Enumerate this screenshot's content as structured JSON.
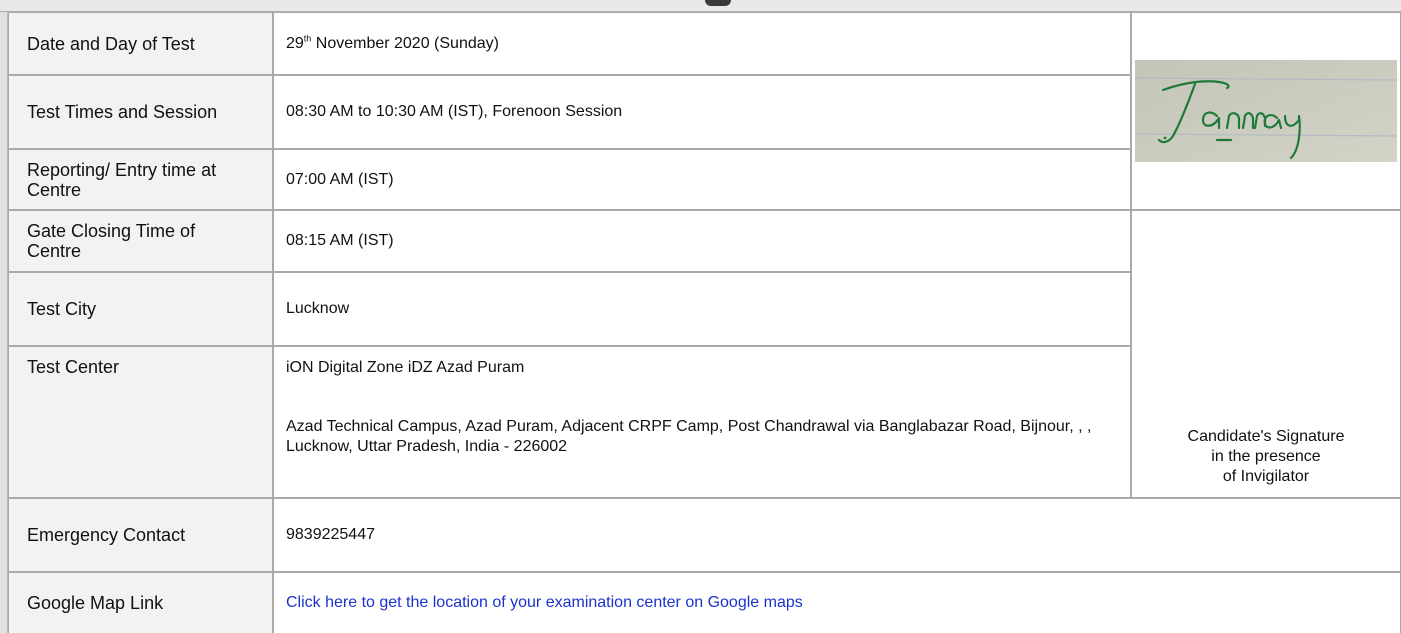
{
  "rows": {
    "date": {
      "label": "Date and Day of Test",
      "value_day": "29",
      "value_suffix": "th",
      "value_rest": " November 2020 (Sunday)"
    },
    "times": {
      "label": "Test Times and Session",
      "value": "08:30 AM to 10:30 AM (IST), Forenoon Session"
    },
    "reporting": {
      "label": "Reporting/ Entry time at Centre",
      "value": "07:00 AM (IST)"
    },
    "gate": {
      "label": "Gate Closing Time of Centre",
      "value": "08:15 AM (IST)"
    },
    "city": {
      "label": "Test City",
      "value": "Lucknow"
    },
    "center": {
      "label": "Test Center",
      "name": "iON Digital Zone iDZ  Azad Puram",
      "address": "Azad Technical Campus, Azad Puram, Adjacent CRPF Camp, Post Chandrawal via Banglabazar Road, Bijnour, , , Lucknow, Uttar Pradesh, India - 226002"
    },
    "emergency": {
      "label": "Emergency Contact",
      "value": "9839225447"
    },
    "map": {
      "label": "Google Map Link",
      "link_text": "Click here to get the location of your examination center on Google maps"
    }
  },
  "signature": {
    "handwritten_name": "Tanmay",
    "caption_line1": "Candidate's Signature",
    "caption_line2": "in the presence",
    "caption_line3": "of Invigilator"
  },
  "colors": {
    "label_bg": "#f2f2f2",
    "border": "#a9a9a9",
    "link": "#1a33cc",
    "ink": "#1f7a3a",
    "paper": "#cbccc0"
  }
}
